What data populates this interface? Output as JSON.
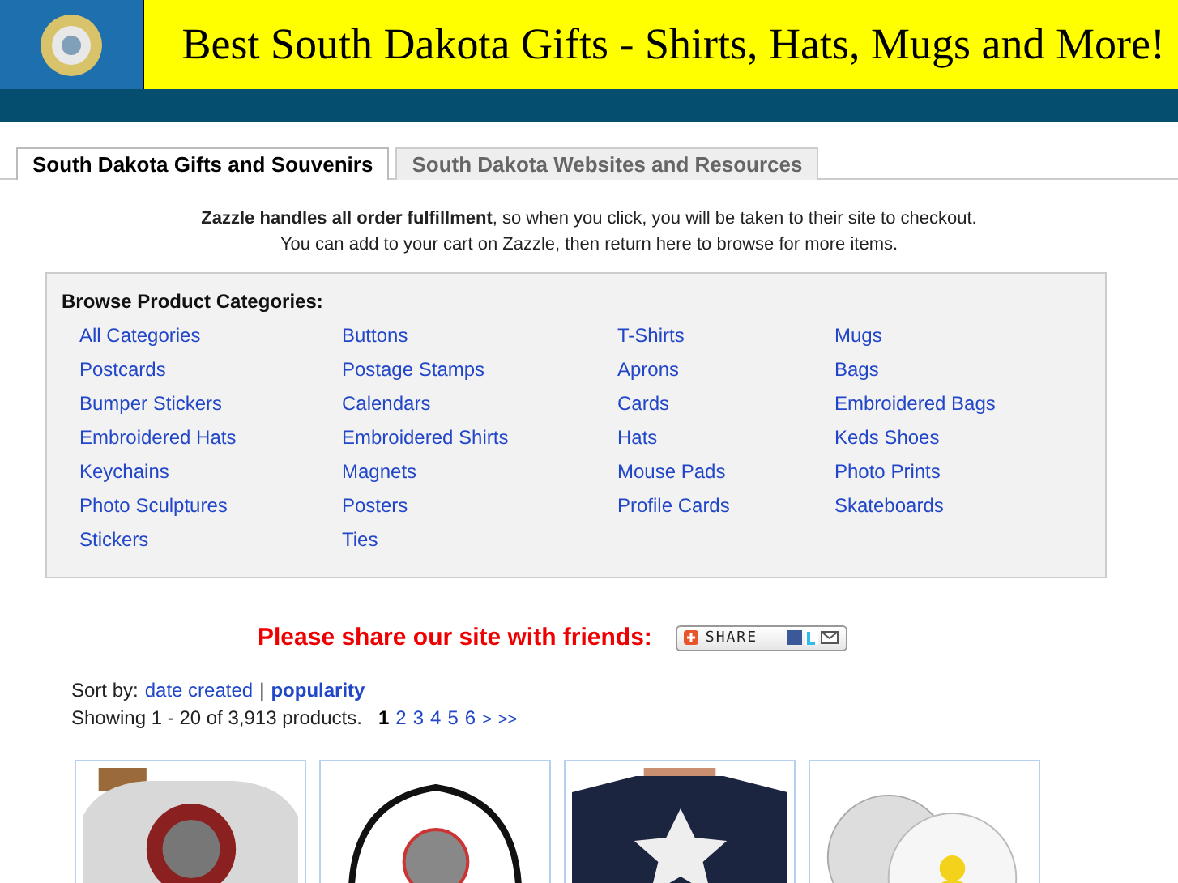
{
  "header": {
    "title": "Best South Dakota Gifts - Shirts, Hats, Mugs and More!"
  },
  "tabs": [
    {
      "label": "South Dakota Gifts and Souvenirs",
      "selected": true
    },
    {
      "label": "South Dakota Websites and Resources",
      "selected": false
    }
  ],
  "notice": [
    "**Zazzle handles all order fulfillment**, so when you click, you will be taken to their site to checkout.",
    "You can add to your cart on Zazzle, then return here to browse for more items."
  ],
  "categories": {
    "heading": "Browse Product Categories:",
    "columns": [
      [
        "All Categories",
        "Postcards",
        "Bumper Stickers",
        "Embroidered Hats",
        "Keychains",
        "Photo Sculptures",
        "Stickers"
      ],
      [
        "Buttons",
        "Postage Stamps",
        "Calendars",
        "Embroidered Shirts",
        "Magnets",
        "Posters",
        "Ties"
      ],
      [
        "T-Shirts",
        "Aprons",
        "Cards",
        "Hats",
        "Mouse Pads",
        "Profile Cards"
      ],
      [
        "Mugs",
        "Bags",
        "Embroidered Bags",
        "Keds Shoes",
        "Photo Prints",
        "Skateboards"
      ]
    ]
  },
  "share": {
    "prompt": "Please share our site with friends:",
    "button": "SHARE"
  },
  "sort": {
    "label": "Sort by:",
    "options": [
      {
        "label": "date created",
        "selected": false
      },
      {
        "label": "popularity",
        "selected": true
      }
    ],
    "separator": "|"
  },
  "results": {
    "summary": "Showing 1 - 20 of 3,913 products.",
    "pages": [
      {
        "label": "1",
        "selected": true
      },
      {
        "label": "2",
        "selected": false
      },
      {
        "label": "3",
        "selected": false
      },
      {
        "label": "4",
        "selected": false
      },
      {
        "label": "5",
        "selected": false
      },
      {
        "label": "6",
        "selected": false
      }
    ],
    "next": ">",
    "last": ">>"
  },
  "products": [
    {
      "kind": "sweatshirt"
    },
    {
      "kind": "cap"
    },
    {
      "kind": "tshirt"
    },
    {
      "kind": "button"
    }
  ]
}
